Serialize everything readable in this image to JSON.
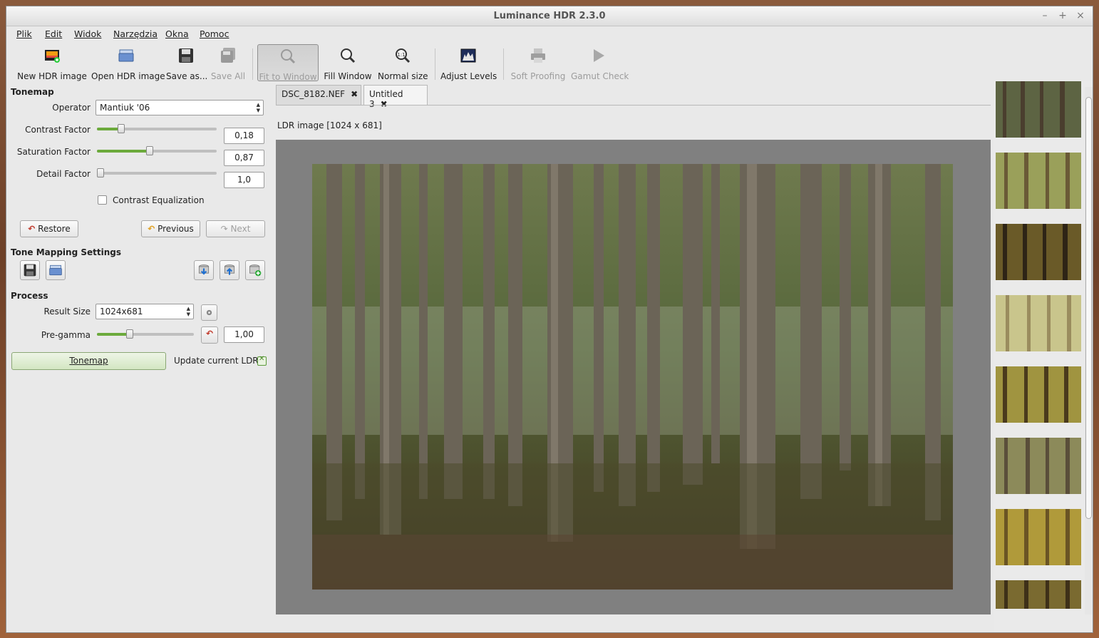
{
  "window": {
    "title": "Luminance HDR 2.3.0"
  },
  "menu": [
    {
      "label": "Plik"
    },
    {
      "label": "Edit"
    },
    {
      "label": "Widok"
    },
    {
      "label": "Narzędzia"
    },
    {
      "label": "Okna"
    },
    {
      "label": "Pomoc"
    }
  ],
  "toolbar": {
    "new_hdr": "New HDR image",
    "open_hdr": "Open HDR image",
    "save_as": "Save as...",
    "save_all": "Save All",
    "fit_window": "Fit to Window",
    "fill_window": "Fill Window",
    "normal_size": "Normal size",
    "adjust_levels": "Adjust Levels",
    "soft_proofing": "Soft Proofing",
    "gamut_check": "Gamut Check"
  },
  "tonemap": {
    "section_title": "Tonemap",
    "operator_label": "Operator",
    "operator_value": "Mantiuk '06",
    "contrast_label": "Contrast Factor",
    "contrast_value": "0,18",
    "contrast_level": 0.2,
    "saturation_label": "Saturation Factor",
    "saturation_value": "0,87",
    "saturation_level": 0.44,
    "detail_label": "Detail Factor",
    "detail_value": "1,0",
    "detail_level": 0.0,
    "equalization_label": "Contrast Equalization",
    "equalization_checked": false,
    "restore_label": "Restore",
    "previous_label": "Previous",
    "next_label": "Next"
  },
  "settings": {
    "section_title": "Tone Mapping Settings"
  },
  "process": {
    "section_title": "Process",
    "result_size_label": "Result Size",
    "result_size_value": "1024x681",
    "pregamma_label": "Pre-gamma",
    "pregamma_value": "1,00",
    "pregamma_level": 0.34,
    "tonemap_button": "Tonemap",
    "update_label": "Update current LDR",
    "update_checked": true
  },
  "tabs": [
    {
      "label": "DSC_8182.NEF"
    },
    {
      "label": "Untitled 3"
    }
  ],
  "viewer": {
    "info": "LDR image [1024 x 681]"
  },
  "colors": {
    "accent_green": "#6caa3c",
    "window_bg": "#e9e9e9",
    "viewer_bg": "#808080"
  }
}
